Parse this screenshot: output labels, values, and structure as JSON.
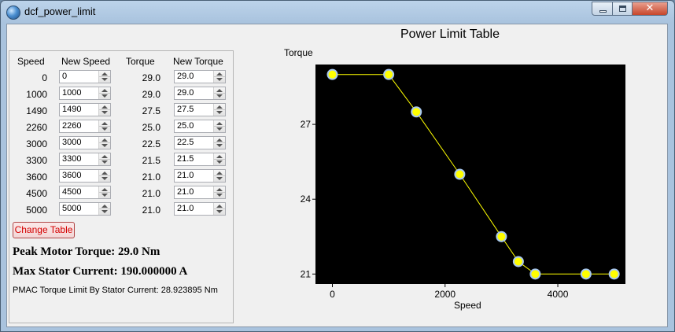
{
  "window": {
    "title": "dcf_power_limit",
    "close_glyph": "✕"
  },
  "table": {
    "headers": {
      "speed": "Speed",
      "new_speed": "New Speed",
      "torque": "Torque",
      "new_torque": "New Torque"
    },
    "rows": [
      {
        "speed": "0",
        "new_speed": "0",
        "torque": "29.0",
        "new_torque": "29.0"
      },
      {
        "speed": "1000",
        "new_speed": "1000",
        "torque": "29.0",
        "new_torque": "29.0"
      },
      {
        "speed": "1490",
        "new_speed": "1490",
        "torque": "27.5",
        "new_torque": "27.5"
      },
      {
        "speed": "2260",
        "new_speed": "2260",
        "torque": "25.0",
        "new_torque": "25.0"
      },
      {
        "speed": "3000",
        "new_speed": "3000",
        "torque": "22.5",
        "new_torque": "22.5"
      },
      {
        "speed": "3300",
        "new_speed": "3300",
        "torque": "21.5",
        "new_torque": "21.5"
      },
      {
        "speed": "3600",
        "new_speed": "3600",
        "torque": "21.0",
        "new_torque": "21.0"
      },
      {
        "speed": "4500",
        "new_speed": "4500",
        "torque": "21.0",
        "new_torque": "21.0"
      },
      {
        "speed": "5000",
        "new_speed": "5000",
        "torque": "21.0",
        "new_torque": "21.0"
      }
    ],
    "change_button": "Change Table"
  },
  "info": {
    "peak_torque": "Peak Motor Torque: 29.0 Nm",
    "max_current": "Max Stator Current: 190.000000 A",
    "pmac_limit": "PMAC Torque Limit By Stator Current: 28.923895 Nm"
  },
  "chart_data": {
    "type": "line",
    "title": "Power Limit Table",
    "xlabel": "Speed",
    "ylabel": "Torque",
    "x": [
      0,
      1000,
      1490,
      2260,
      3000,
      3300,
      3600,
      4500,
      5000
    ],
    "y": [
      29.0,
      29.0,
      27.5,
      25.0,
      22.5,
      21.5,
      21.0,
      21.0,
      21.0
    ],
    "xlim": [
      -300,
      5200
    ],
    "ylim": [
      20.6,
      29.4
    ],
    "xticks": [
      0,
      2000,
      4000
    ],
    "yticks": [
      21,
      24,
      27
    ],
    "grid": false,
    "colors": {
      "background": "#000000",
      "line": "#ffff00",
      "marker_fill": "#ffff00",
      "marker_edge": "#a8c8f0"
    }
  }
}
